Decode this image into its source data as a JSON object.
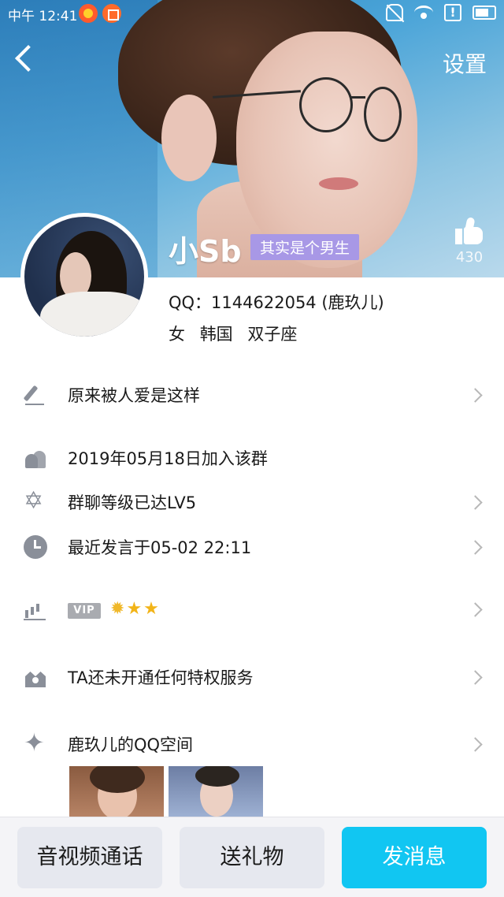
{
  "status_bar": {
    "time": "中午 12:41",
    "alert_glyph": "!"
  },
  "header": {
    "settings_label": "设置"
  },
  "profile": {
    "nickname": "小Sb",
    "tag": "其实是个男生",
    "likes": "430",
    "qq_line": "QQ：1144622054 (鹿玖儿)",
    "gender": "女",
    "location": "韩国",
    "zodiac": "双子座"
  },
  "rows": {
    "signature": "原来被人爱是这样",
    "joined": "2019年05月18日加入该群",
    "group_level": "群聊等级已达LV5",
    "last_spoke": "最近发言于05-02 22:11",
    "vip_label": "VIP",
    "vip_icons": [
      "sun",
      "star",
      "star"
    ],
    "privilege": "TA还未开通任何特权服务",
    "qzone": "鹿玖儿的QQ空间"
  },
  "bottom_bar": {
    "call_label": "音视频通话",
    "gift_label": "送礼物",
    "message_label": "发消息"
  },
  "colors": {
    "accent": "#11c6f2",
    "tag_bg": "#a898e6",
    "icon_gray": "#8a8f99",
    "button_gray": "#e6e8ef"
  }
}
